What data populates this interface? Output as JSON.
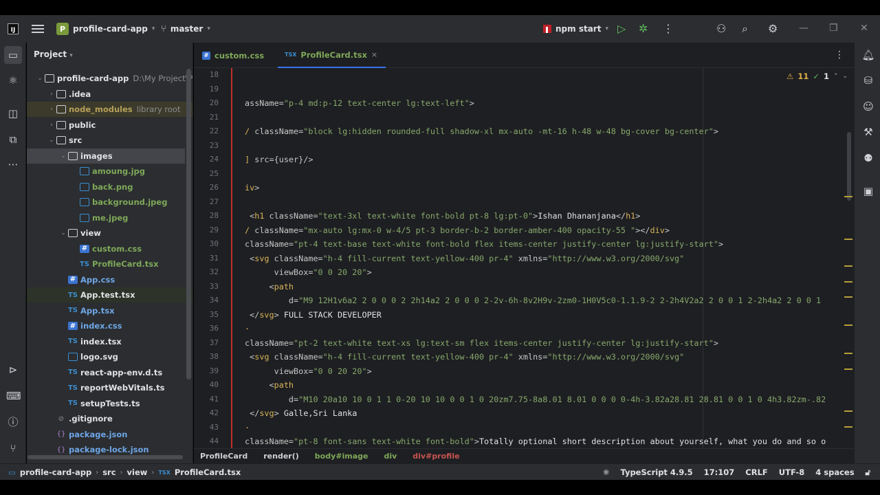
{
  "titlebar": {
    "logo": "IJ",
    "project_badge": "P",
    "project_name": "profile-card-app",
    "branch": "master",
    "run_config": "npm start"
  },
  "project_panel": {
    "title": "Project",
    "tree": [
      {
        "label": "profile-card-app",
        "hint": "D:\\My Project\\P",
        "level": 0,
        "type": "folder",
        "expanded": true
      },
      {
        "label": ".idea",
        "level": 1,
        "type": "folder",
        "expanded": false
      },
      {
        "label": "node_modules",
        "hint": "library root",
        "level": 1,
        "type": "folder",
        "expanded": false,
        "style": "yellow"
      },
      {
        "label": "public",
        "level": 1,
        "type": "folder",
        "expanded": false
      },
      {
        "label": "src",
        "level": 1,
        "type": "folder",
        "expanded": true
      },
      {
        "label": "images",
        "level": 2,
        "type": "folder",
        "expanded": true,
        "selected": true
      },
      {
        "label": "amoung.jpg",
        "level": 3,
        "type": "image",
        "style": "green"
      },
      {
        "label": "back.png",
        "level": 3,
        "type": "image",
        "style": "green"
      },
      {
        "label": "background.jpeg",
        "level": 3,
        "type": "image",
        "style": "green"
      },
      {
        "label": "me.jpeg",
        "level": 3,
        "type": "image",
        "style": "green"
      },
      {
        "label": "view",
        "level": 2,
        "type": "folder",
        "expanded": true
      },
      {
        "label": "custom.css",
        "level": 3,
        "type": "css",
        "style": "green"
      },
      {
        "label": "ProfileCard.tsx",
        "level": 3,
        "type": "tsx",
        "style": "green"
      },
      {
        "label": "App.css",
        "level": 2,
        "type": "css",
        "style": "blue"
      },
      {
        "label": "App.test.tsx",
        "level": 2,
        "type": "tsx",
        "highlight": true
      },
      {
        "label": "App.tsx",
        "level": 2,
        "type": "tsx",
        "style": "blue"
      },
      {
        "label": "index.css",
        "level": 2,
        "type": "css",
        "style": "blue"
      },
      {
        "label": "index.tsx",
        "level": 2,
        "type": "tsx"
      },
      {
        "label": "logo.svg",
        "level": 2,
        "type": "image"
      },
      {
        "label": "react-app-env.d.ts",
        "level": 2,
        "type": "tsx"
      },
      {
        "label": "reportWebVitals.ts",
        "level": 2,
        "type": "tsx"
      },
      {
        "label": "setupTests.ts",
        "level": 2,
        "type": "tsx"
      },
      {
        "label": ".gitignore",
        "level": 1,
        "type": "git"
      },
      {
        "label": "package.json",
        "level": 1,
        "type": "json",
        "style": "blue"
      },
      {
        "label": "package-lock.json",
        "level": 1,
        "type": "json",
        "style": "blue"
      }
    ]
  },
  "tabs": [
    {
      "label": "custom.css",
      "icon": "#",
      "active": false
    },
    {
      "label": "ProfileCard.tsx",
      "icon": "TSX",
      "active": true,
      "close": "×"
    }
  ],
  "inspections": {
    "warnings": "11",
    "ok": "1"
  },
  "code_lines": [
    {
      "n": "18",
      "parts": []
    },
    {
      "n": "19",
      "parts": []
    },
    {
      "n": "20",
      "parts": [
        {
          "c": "a",
          "t": "assName="
        },
        {
          "c": "s",
          "t": "\"p-4 md:p-12 text-center lg:text-left\""
        },
        {
          "c": "a",
          "t": ">"
        }
      ]
    },
    {
      "n": "21",
      "parts": []
    },
    {
      "n": "22",
      "parts": [
        {
          "c": "t",
          "t": "/"
        },
        {
          "c": "a",
          "t": " className="
        },
        {
          "c": "s",
          "t": "\"block lg:hidden rounded-full shadow-xl mx-auto -mt-16 h-48 w-48 bg-cover bg-center\""
        },
        {
          "c": "a",
          "t": ">"
        }
      ]
    },
    {
      "n": "23",
      "parts": []
    },
    {
      "n": "24",
      "parts": [
        {
          "c": "t",
          "t": "]"
        },
        {
          "c": "a",
          "t": " src={user}/>"
        }
      ]
    },
    {
      "n": "25",
      "parts": []
    },
    {
      "n": "26",
      "parts": [
        {
          "c": "t",
          "t": "iv"
        },
        {
          "c": "a",
          "t": ">"
        }
      ]
    },
    {
      "n": "27",
      "parts": []
    },
    {
      "n": "28",
      "parts": [
        {
          "c": "a",
          "t": " <"
        },
        {
          "c": "t",
          "t": "h1"
        },
        {
          "c": "a",
          "t": " className="
        },
        {
          "c": "s",
          "t": "\"text-3xl text-white font-bold pt-8 lg:pt-0\""
        },
        {
          "c": "a",
          "t": ">"
        },
        {
          "c": "txt",
          "t": "Ishan Dhananjana"
        },
        {
          "c": "a",
          "t": "</"
        },
        {
          "c": "t",
          "t": "h1"
        },
        {
          "c": "a",
          "t": ">"
        }
      ]
    },
    {
      "n": "29",
      "parts": [
        {
          "c": "t",
          "t": "/"
        },
        {
          "c": "a",
          "t": " className="
        },
        {
          "c": "s",
          "t": "\"mx-auto lg:mx-0 w-4/5 pt-3 border-b-2 border-amber-400 opacity-55 \""
        },
        {
          "c": "a",
          "t": "></"
        },
        {
          "c": "t",
          "t": "div"
        },
        {
          "c": "a",
          "t": ">"
        }
      ]
    },
    {
      "n": "30",
      "parts": [
        {
          "c": "a",
          "t": "className="
        },
        {
          "c": "s",
          "t": "\"pt-4 text-base text-white font-bold flex items-center justify-center lg:justify-start\""
        },
        {
          "c": "a",
          "t": ">"
        }
      ]
    },
    {
      "n": "31",
      "parts": [
        {
          "c": "a",
          "t": " <"
        },
        {
          "c": "t",
          "t": "svg"
        },
        {
          "c": "a",
          "t": " className="
        },
        {
          "c": "s",
          "t": "\"h-4 fill-current text-yellow-400 pr-4\""
        },
        {
          "c": "a",
          "t": " xmlns="
        },
        {
          "c": "s",
          "t": "\"http://www.w3.org/2000/svg\""
        }
      ]
    },
    {
      "n": "32",
      "parts": [
        {
          "c": "a",
          "t": "      viewBox="
        },
        {
          "c": "s",
          "t": "\"0 0 20 20\""
        },
        {
          "c": "a",
          "t": ">"
        }
      ]
    },
    {
      "n": "33",
      "parts": [
        {
          "c": "a",
          "t": "     <"
        },
        {
          "c": "t",
          "t": "path"
        }
      ]
    },
    {
      "n": "34",
      "parts": [
        {
          "c": "a",
          "t": "         d="
        },
        {
          "c": "s",
          "t": "\"M9 12H1v6a2 2 0 0 0 2 2h14a2 2 0 0 0 2-2v-6h-8v2H9v-2zm0-1H0V5c0-1.1.9-2 2-2h4V2a2 2 0 0 1 2-2h4a2 2 0 0 1"
        }
      ]
    },
    {
      "n": "35",
      "parts": [
        {
          "c": "a",
          "t": " </"
        },
        {
          "c": "t",
          "t": "svg"
        },
        {
          "c": "a",
          "t": "> "
        },
        {
          "c": "txt",
          "t": "FULL STACK DEVELOPER"
        }
      ]
    },
    {
      "n": "36",
      "parts": [
        {
          "c": "t",
          "t": "·"
        }
      ]
    },
    {
      "n": "37",
      "parts": [
        {
          "c": "a",
          "t": "className="
        },
        {
          "c": "s",
          "t": "\"pt-2 text-white text-xs lg:text-sm flex items-center justify-center lg:justify-start\""
        },
        {
          "c": "a",
          "t": ">"
        }
      ]
    },
    {
      "n": "38",
      "parts": [
        {
          "c": "a",
          "t": " <"
        },
        {
          "c": "t",
          "t": "svg"
        },
        {
          "c": "a",
          "t": " className="
        },
        {
          "c": "s",
          "t": "\"h-4 fill-current text-yellow-400 pr-4\""
        },
        {
          "c": "a",
          "t": " xmlns="
        },
        {
          "c": "s",
          "t": "\"http://www.w3.org/2000/svg\""
        }
      ]
    },
    {
      "n": "39",
      "parts": [
        {
          "c": "a",
          "t": "      viewBox="
        },
        {
          "c": "s",
          "t": "\"0 0 20 20\""
        },
        {
          "c": "a",
          "t": ">"
        }
      ]
    },
    {
      "n": "40",
      "parts": [
        {
          "c": "a",
          "t": "     <"
        },
        {
          "c": "t",
          "t": "path"
        }
      ]
    },
    {
      "n": "41",
      "parts": [
        {
          "c": "a",
          "t": "         d="
        },
        {
          "c": "s",
          "t": "\"M10 20a10 10 0 1 1 0-20 10 10 0 0 1 0 20zm7.75-8a8.01 8.01 0 0 0 0-4h-3.82a28.81 28.81 0 0 1 0 4h3.82zm-.82"
        }
      ]
    },
    {
      "n": "42",
      "parts": [
        {
          "c": "a",
          "t": " </"
        },
        {
          "c": "t",
          "t": "svg"
        },
        {
          "c": "a",
          "t": "> "
        },
        {
          "c": "txt",
          "t": "Galle,Sri Lanka"
        }
      ]
    },
    {
      "n": "43",
      "parts": [
        {
          "c": "t",
          "t": "·"
        }
      ]
    },
    {
      "n": "44",
      "parts": [
        {
          "c": "a",
          "t": "className="
        },
        {
          "c": "s",
          "t": "\"pt-8 font-sans text-white font-bold\""
        },
        {
          "c": "a",
          "t": ">"
        },
        {
          "c": "txt",
          "t": "Totally optional short description about yourself, what you do and so o"
        }
      ]
    }
  ],
  "code_breadcrumbs": [
    {
      "label": "ProfileCard",
      "style": ""
    },
    {
      "label": "render()",
      "style": ""
    },
    {
      "label": "body#image",
      "style": "g"
    },
    {
      "label": "div",
      "style": "g"
    },
    {
      "label": "div#profile",
      "style": "r"
    }
  ],
  "statusbar": {
    "path": [
      "profile-card-app",
      "src",
      "view",
      "ProfileCard.tsx"
    ],
    "language": "TypeScript 4.9.5",
    "position": "17:107",
    "line_sep": "CRLF",
    "encoding": "UTF-8",
    "indent": "4 spaces"
  },
  "colors": {
    "accent": "#3574f0",
    "tag": "#d8b45a",
    "string": "#86a86c",
    "panel": "#2b2d30",
    "editor": "#1e1f22"
  }
}
